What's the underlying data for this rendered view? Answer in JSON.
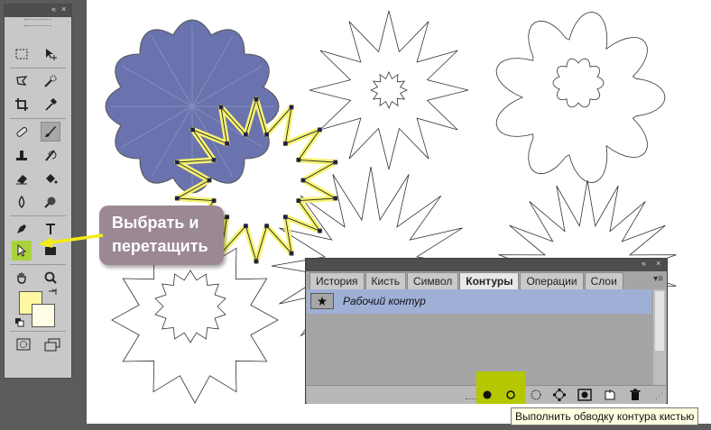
{
  "callout": {
    "line1": "Выбрать и",
    "line2": "перетащить"
  },
  "paths_panel": {
    "tabs": [
      "История",
      "Кисть",
      "Символ",
      "Контуры",
      "Операции",
      "Слои"
    ],
    "active_tab": "Контуры",
    "items": [
      {
        "label": "Рабочий контур"
      }
    ]
  },
  "tooltip": {
    "text": "Выполнить обводку контура кистью"
  },
  "colors": {
    "fill_shape": "#6a73ad",
    "selection_glow": "#f6f373",
    "button_highlight": "#b4c700",
    "foreground": "#fff8a0",
    "background": "#fffde6",
    "selected_row": "#9fb0d7",
    "callout_bg": "#9b8894"
  },
  "tools": [
    "marquee-tool",
    "move-tool",
    "lasso-tool",
    "quick-selection-tool",
    "crop-tool",
    "eyedropper-tool",
    "healing-tool",
    "brush-tool",
    "stamp-tool",
    "history-brush-tool",
    "eraser-tool",
    "paint-bucket-tool",
    "blur-tool",
    "dodge-tool",
    "pen-tool",
    "type-tool",
    "path-selection-tool",
    "shape-tool",
    "hand-tool",
    "zoom-tool"
  ]
}
